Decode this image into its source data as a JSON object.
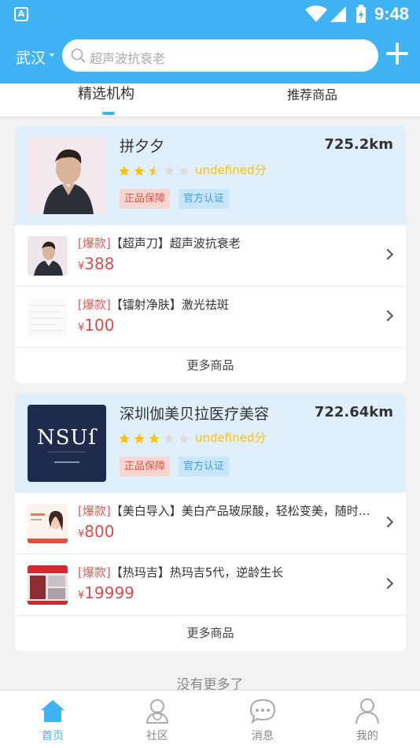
{
  "status_bar": {
    "app_icon_letter": "A",
    "time": "9:48"
  },
  "header": {
    "city": "武汉",
    "search_placeholder": "超声波抗衰老",
    "accent_color": "#40b3f4"
  },
  "tabs": [
    {
      "label": "精选机构",
      "active": true
    },
    {
      "label": "推荐商品",
      "active": false
    }
  ],
  "stores": [
    {
      "name": "拼夕夕",
      "distance": "725.2km",
      "rating": 2.5,
      "score_text": "undefined分",
      "badges": [
        "正品保障",
        "官方认证"
      ],
      "products": [
        {
          "tag": "[爆款]",
          "title": "【超声刀】超声波抗衰老",
          "yen": "¥",
          "price": "388"
        },
        {
          "tag": "[爆款]",
          "title": "【镭射净肤】激光祛斑",
          "yen": "¥",
          "price": "100"
        }
      ],
      "more_label": "更多商品"
    },
    {
      "name": "深圳伽美贝拉医疗美容",
      "distance": "722.64km",
      "rating": 3,
      "score_text": "undefined分",
      "logo_text": "NSUſ",
      "badges": [
        "正品保障",
        "官方认证"
      ],
      "products": [
        {
          "tag": "[爆款]",
          "title": "【美白导入】美白产品玻尿酸，轻松变美，随时随地",
          "yen": "¥",
          "price": "800"
        },
        {
          "tag": "[爆款]",
          "title": "【热玛吉】热玛吉5代，逆龄生长",
          "yen": "¥",
          "price": "19999"
        }
      ],
      "more_label": "更多商品"
    }
  ],
  "no_more": "没有更多了",
  "bottom_nav": [
    {
      "label": "首页",
      "icon": "home-icon",
      "active": true
    },
    {
      "label": "社区",
      "icon": "community-icon",
      "active": false
    },
    {
      "label": "消息",
      "icon": "message-icon",
      "active": false
    },
    {
      "label": "我的",
      "icon": "profile-icon",
      "active": false
    }
  ]
}
